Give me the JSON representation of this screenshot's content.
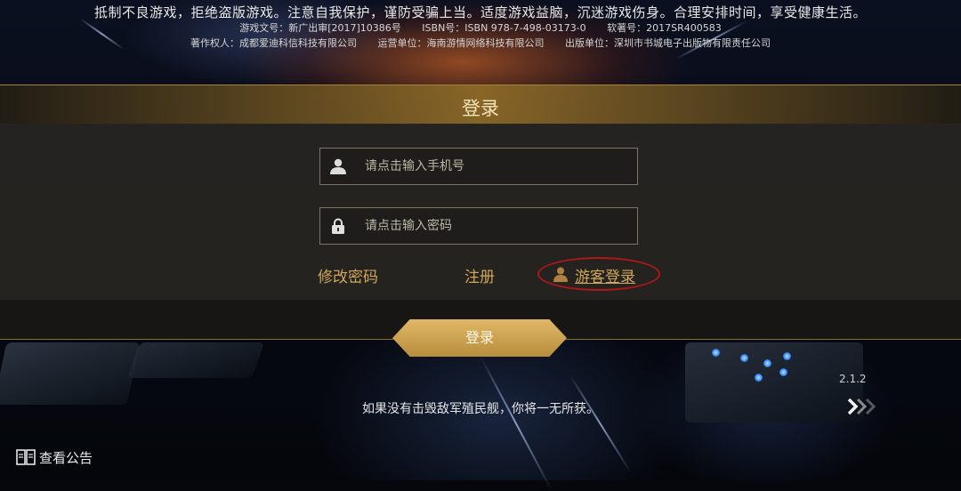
{
  "notice": {
    "main": "抵制不良游戏，拒绝盗版游戏。注意自我保护，谨防受骗上当。适度游戏益脑，沉迷游戏伤身。合理安排时间，享受健康生活。",
    "line2": [
      "游戏文号：新广出审[2017]10386号",
      "ISBN号：ISBN 978-7-498-03173-0",
      "软著号：2017SR400583"
    ],
    "line3": [
      "著作权人：成都爱迪科信科技有限公司",
      "运营单位：海南游情网络科技有限公司",
      "出版单位：深圳市书城电子出版物有限责任公司"
    ]
  },
  "login_panel": {
    "title": "登录",
    "phone_placeholder": "请点击输入手机号",
    "password_placeholder": "请点击输入密码",
    "change_password": "修改密码",
    "register": "注册",
    "guest_login": "游客登录",
    "login_button": "登录"
  },
  "footer": {
    "version": "2.1.2",
    "hint": "如果没有击毁敌军殖民舰，你将一无所获。",
    "announcement": "查看公告"
  },
  "colors": {
    "accent_gold": "#cfa65a",
    "button_gold": "#d4ad5d",
    "highlight_red": "#b01818"
  },
  "icons": {
    "phone_field": "user-icon",
    "password_field": "lock-icon",
    "guest": "guest-icon",
    "next": "double-chevron-right-icon",
    "announcement": "book-icon"
  }
}
